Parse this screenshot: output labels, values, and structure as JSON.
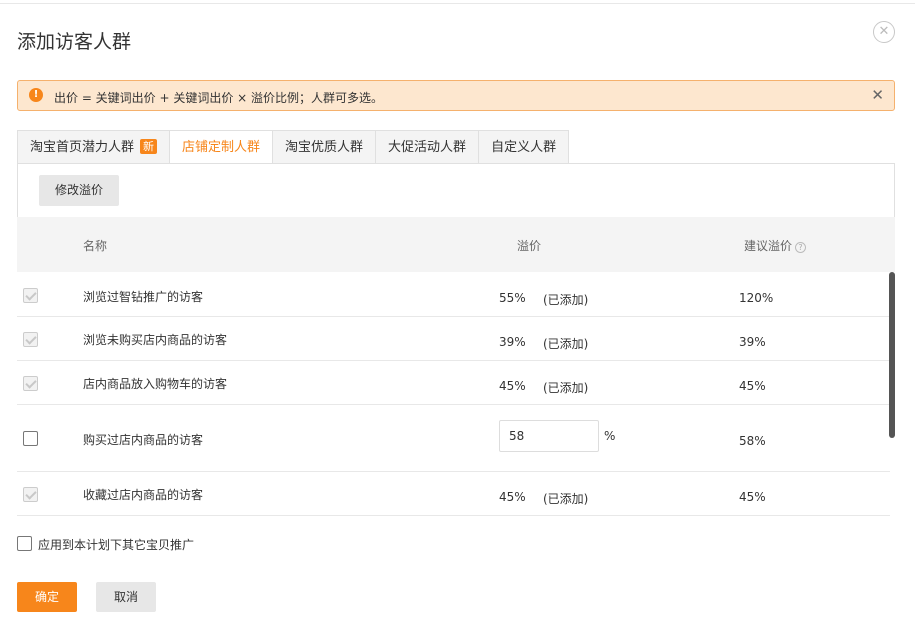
{
  "dialog": {
    "title": "添加访客人群",
    "close_symbol": "✕"
  },
  "alert": {
    "icon_name": "exclamation-icon",
    "icon_glyph": "!",
    "text": "出价 = 关键词出价 + 关键词出价 × 溢价比例；人群可多选。",
    "close_symbol": "✕"
  },
  "tabs": [
    {
      "label": "淘宝首页潜力人群",
      "badge": "新",
      "active": false
    },
    {
      "label": "店铺定制人群",
      "active": true
    },
    {
      "label": "淘宝优质人群",
      "active": false
    },
    {
      "label": "大促活动人群",
      "active": false
    },
    {
      "label": "自定义人群",
      "active": false
    }
  ],
  "toolbar": {
    "edit_label": "修改溢价"
  },
  "table": {
    "headers": {
      "name": "名称",
      "bid": "溢价",
      "suggested": "建议溢价"
    },
    "rows": [
      {
        "checked": true,
        "disabled": true,
        "name": "浏览过智钻推广的访客",
        "bid": "55%",
        "status": "(已添加)",
        "suggested": "120%"
      },
      {
        "checked": true,
        "disabled": true,
        "name": "浏览未购买店内商品的访客",
        "bid": "39%",
        "status": "(已添加)",
        "suggested": "39%"
      },
      {
        "checked": true,
        "disabled": true,
        "name": "店内商品放入购物车的访客",
        "bid": "45%",
        "status": "(已添加)",
        "suggested": "45%"
      },
      {
        "checked": false,
        "disabled": false,
        "name": "购买过店内商品的访客",
        "bid_input": "58",
        "unit": "%",
        "suggested": "58%"
      },
      {
        "checked": true,
        "disabled": true,
        "name": "收藏过店内商品的访客",
        "bid": "45%",
        "status": "(已添加)",
        "suggested": "45%"
      }
    ]
  },
  "apply_all": {
    "label": "应用到本计划下其它宝贝推广",
    "checked": false
  },
  "footer": {
    "ok_label": "确定",
    "cancel_label": "取消"
  },
  "colors": {
    "accent": "#f7861b",
    "alert_bg": "#fde7cf",
    "alert_border": "#f5b16d"
  }
}
